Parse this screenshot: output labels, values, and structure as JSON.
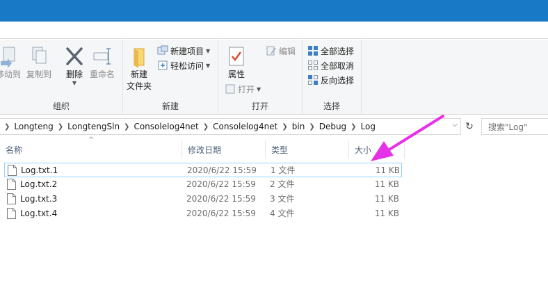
{
  "ribbon": {
    "groups": [
      {
        "label": "组织"
      },
      {
        "label": "新建"
      },
      {
        "label": "打开"
      },
      {
        "label": "选择"
      }
    ],
    "buttons": {
      "move_to": "移动到",
      "copy_to": "复制到",
      "delete": "删除",
      "rename": "重命名",
      "new_folder_1": "新建",
      "new_folder_2": "文件夹",
      "new_item": "新建项目",
      "easy_access": "轻松访问",
      "properties": "属性",
      "open": "打开",
      "edit": "编辑",
      "select_all": "全部选择",
      "select_none": "全部取消",
      "invert_selection": "反向选择"
    }
  },
  "address": {
    "crumbs": [
      "Longteng",
      "LongtengSln",
      "Consolelog4net",
      "Consolelog4net",
      "bin",
      "Debug",
      "Log"
    ],
    "search_placeholder": "搜索\"Log\""
  },
  "columns": {
    "name": "名称",
    "date": "修改日期",
    "type": "类型",
    "size": "大小"
  },
  "files": [
    {
      "name": "Log.txt.1",
      "date": "2020/6/22 15:59",
      "type": "1 文件",
      "size": "11 KB"
    },
    {
      "name": "Log.txt.2",
      "date": "2020/6/22 15:59",
      "type": "2 文件",
      "size": "11 KB"
    },
    {
      "name": "Log.txt.3",
      "date": "2020/6/22 15:59",
      "type": "3 文件",
      "size": "11 KB"
    },
    {
      "name": "Log.txt.4",
      "date": "2020/6/22 15:59",
      "type": "4 文件",
      "size": "11 KB"
    }
  ],
  "colors": {
    "titlebar": "#1879c7",
    "annotation_arrow": "#e632e6",
    "selection_border": "#99d1ff"
  }
}
